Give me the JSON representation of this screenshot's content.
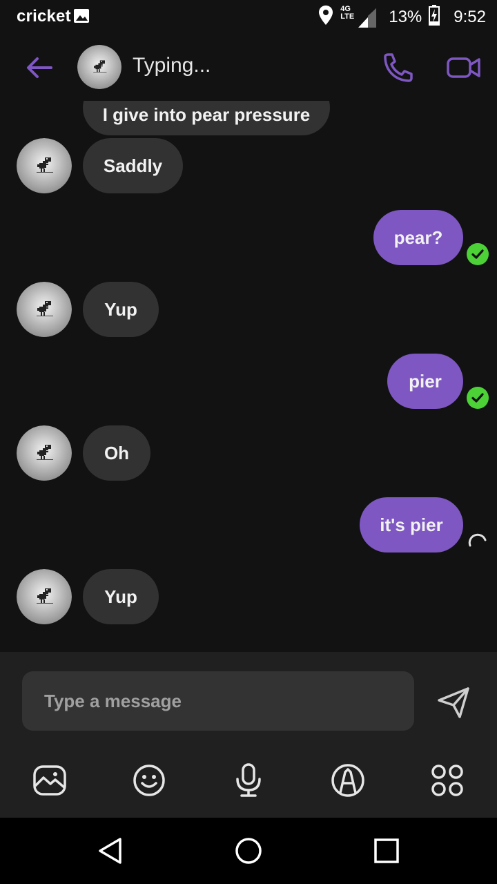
{
  "status_bar": {
    "carrier": "cricket",
    "network": "4G LTE",
    "battery": "13%",
    "time": "9:52"
  },
  "header": {
    "status": "Typing..."
  },
  "messages": [
    {
      "direction": "in",
      "text": "I give into pear pressure"
    },
    {
      "direction": "in",
      "text": "Saddly"
    },
    {
      "direction": "out",
      "text": "pear?",
      "state": "delivered"
    },
    {
      "direction": "in",
      "text": "Yup"
    },
    {
      "direction": "out",
      "text": "pier",
      "state": "delivered"
    },
    {
      "direction": "in",
      "text": "Oh"
    },
    {
      "direction": "out",
      "text": "it's pier",
      "state": "sending"
    },
    {
      "direction": "in",
      "text": "Yup"
    }
  ],
  "compose": {
    "placeholder": "Type a message"
  },
  "toolbar": [
    "gallery-icon",
    "emoji-icon",
    "microphone-icon",
    "doodle-icon",
    "apps-icon"
  ],
  "colors": {
    "accent": "#7e57c2",
    "incoming_bubble": "#323233",
    "delivered_check": "#4cd137",
    "background": "#121213"
  }
}
